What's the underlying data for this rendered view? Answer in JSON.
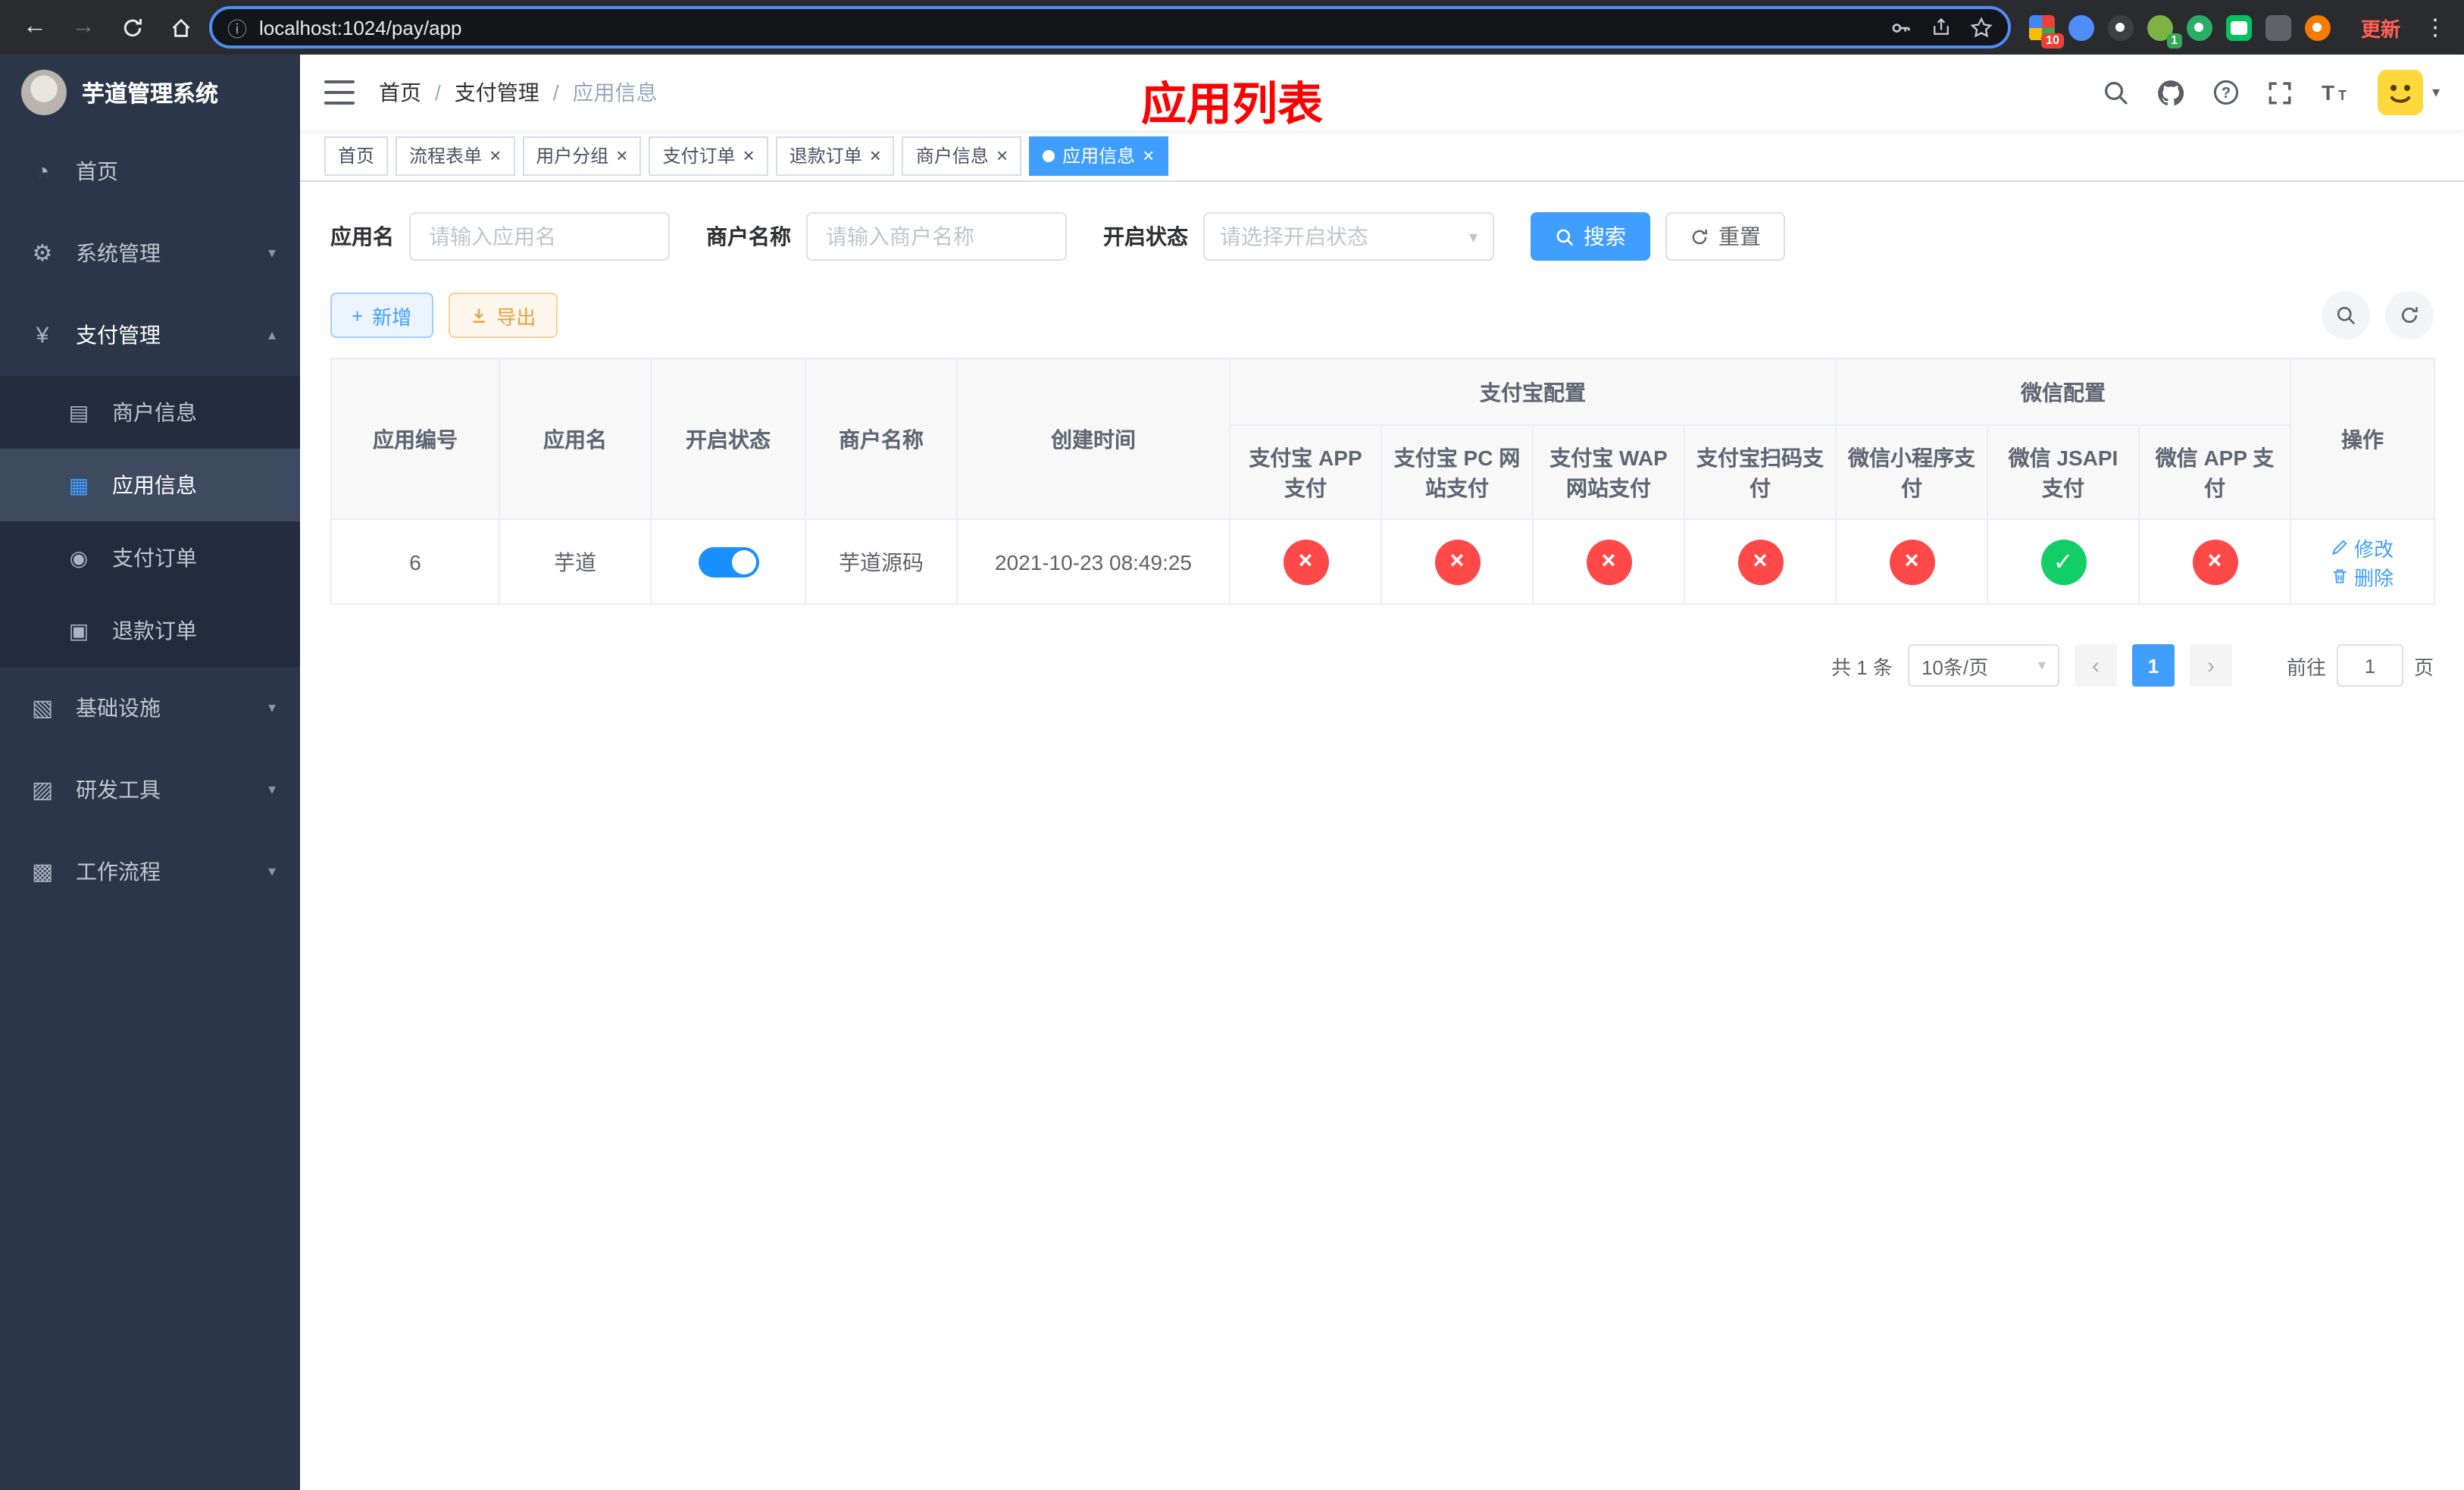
{
  "browser": {
    "url": "localhost:1024/pay/app",
    "update_label": "更新",
    "ext_badge_grid": "10",
    "ext_badge_avatar": "1"
  },
  "icons": {
    "back": "←",
    "forward": "→",
    "info": "ⓘ",
    "kebab": "⋮",
    "home": "◔",
    "system": "⚙",
    "payment": "¥",
    "merchant": "▤",
    "app": "▦",
    "order": "◉",
    "refund": "▣",
    "infra": "▧",
    "devtools": "▨",
    "workflow": "▩",
    "chevron_down": "▾",
    "chevron_up": "▴",
    "check": "✓",
    "cross": "×",
    "plus": "+"
  },
  "sidebar": {
    "title": "芋道管理系统",
    "home": "首页",
    "system": "系统管理",
    "payment": "支付管理",
    "merchant_info": "商户信息",
    "app_info": "应用信息",
    "pay_order": "支付订单",
    "refund_order": "退款订单",
    "infra": "基础设施",
    "dev_tools": "研发工具",
    "workflow": "工作流程"
  },
  "header": {
    "breadcrumb": [
      "首页",
      "支付管理",
      "应用信息"
    ],
    "title": "应用列表"
  },
  "tabs": [
    "首页",
    "流程表单",
    "用户分组",
    "支付订单",
    "退款订单",
    "商户信息",
    "应用信息"
  ],
  "filters": {
    "app_name_label": "应用名",
    "app_name_placeholder": "请输入应用名",
    "merchant_label": "商户名称",
    "merchant_placeholder": "请输入商户名称",
    "status_label": "开启状态",
    "status_placeholder": "请选择开启状态",
    "search": "搜索",
    "reset": "重置"
  },
  "toolbar": {
    "add": "新增",
    "export": "导出"
  },
  "table": {
    "headers": {
      "app_id": "应用编号",
      "app_name": "应用名",
      "status": "开启状态",
      "merchant": "商户名称",
      "created": "创建时间",
      "alipay_group": "支付宝配置",
      "wechat_group": "微信配置",
      "actions": "操作",
      "alipay_app": "支付宝 APP 支付",
      "alipay_pc": "支付宝 PC 网站支付",
      "alipay_wap": "支付宝 WAP 网站支付",
      "alipay_qr": "支付宝扫码支付",
      "wx_mini": "微信小程序支付",
      "wx_jsapi": "微信 JSAPI 支付",
      "wx_app": "微信 APP 支付"
    },
    "rows": [
      {
        "id": "6",
        "name": "芋道",
        "enabled": true,
        "merchant_name": "芋道源码",
        "created_at": "2021-10-23 08:49:25",
        "configs": [
          false,
          false,
          false,
          false,
          false,
          true,
          false
        ],
        "actions": {
          "edit": "修改",
          "delete": "删除"
        }
      }
    ]
  },
  "pagination": {
    "total": "共 1 条",
    "page_size": "10条/页",
    "prev": "‹",
    "next": "›",
    "current_page": "1",
    "goto_label": "前往",
    "goto_value": "1",
    "goto_suffix": "页"
  },
  "colors": {
    "primary": "#409eff",
    "danger": "#ff4949",
    "success": "#13ce66",
    "title_red": "#ff0000",
    "sidebar_bg": "#2b3648"
  }
}
